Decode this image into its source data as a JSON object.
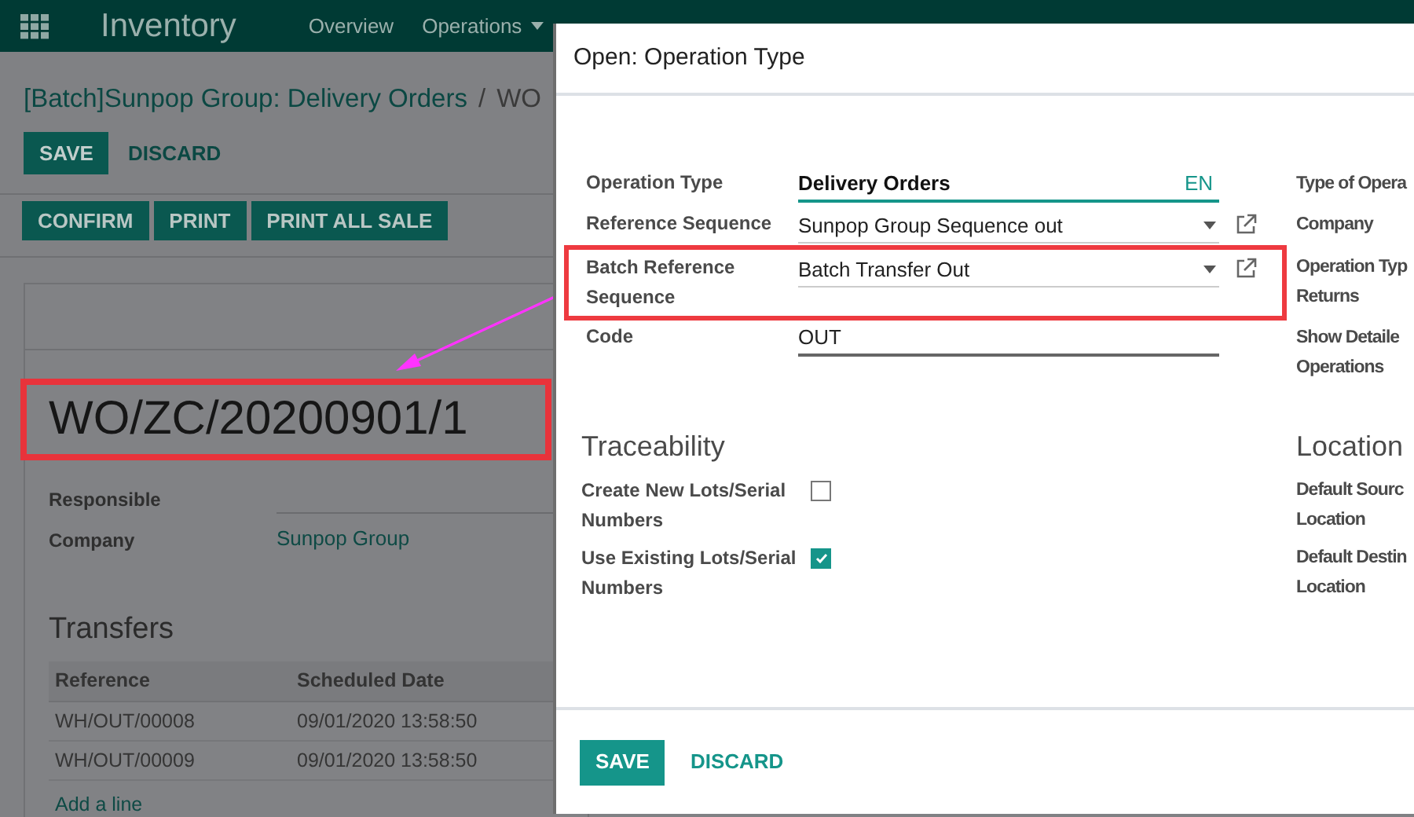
{
  "navbar": {
    "app_title": "Inventory",
    "menu": [
      {
        "label": "Overview",
        "dropdown": false
      },
      {
        "label": "Operations",
        "dropdown": true
      }
    ]
  },
  "breadcrumb": {
    "parent": "[Batch]Sunpop Group: Delivery Orders",
    "separator": "/",
    "current": "WO"
  },
  "form_buttons": {
    "save": "SAVE",
    "discard": "DISCARD"
  },
  "header_buttons": [
    "CONFIRM",
    "PRINT",
    "PRINT ALL SALE"
  ],
  "record": {
    "title": "WO/ZC/20200901/1",
    "fields": [
      {
        "label": "Responsible",
        "kind": "input"
      },
      {
        "label": "Company",
        "value": "Sunpop Group",
        "kind": "link"
      }
    ]
  },
  "transfers": {
    "title": "Transfers",
    "columns": [
      "Reference",
      "Scheduled Date"
    ],
    "rows": [
      [
        "WH/OUT/00008",
        "09/01/2020 13:58:50"
      ],
      [
        "WH/OUT/00009",
        "09/01/2020 13:58:50"
      ]
    ],
    "add_line": "Add a line"
  },
  "dialog": {
    "title": "Open: Operation Type",
    "fields": [
      {
        "label": "Operation Type",
        "value": "Delivery Orders",
        "kind": "translatable",
        "lang": "EN",
        "highlighted": false
      },
      {
        "label": "Reference Sequence",
        "value": "Sunpop Group Sequence out",
        "kind": "select",
        "highlighted": false
      },
      {
        "label": "Batch Reference Sequence",
        "value": "Batch Transfer Out",
        "kind": "select",
        "highlighted": true
      },
      {
        "label": "Code",
        "value": "OUT",
        "kind": "text",
        "highlighted": false
      }
    ],
    "side_fields": [
      "Type of Opera",
      "Company",
      "Operation Typ\nReturns",
      "Show Detaile\nOperations"
    ],
    "traceability": {
      "title": "Traceability",
      "options": [
        {
          "label": "Create New Lots/Serial Numbers",
          "checked": false
        },
        {
          "label": "Use Existing Lots/Serial Numbers",
          "checked": true
        }
      ]
    },
    "locations": {
      "title": "Location",
      "fields": [
        "Default Sourc\nLocation",
        "Default Destin\nLocation"
      ]
    },
    "footer": {
      "save": "SAVE",
      "discard": "DISCARD"
    }
  }
}
